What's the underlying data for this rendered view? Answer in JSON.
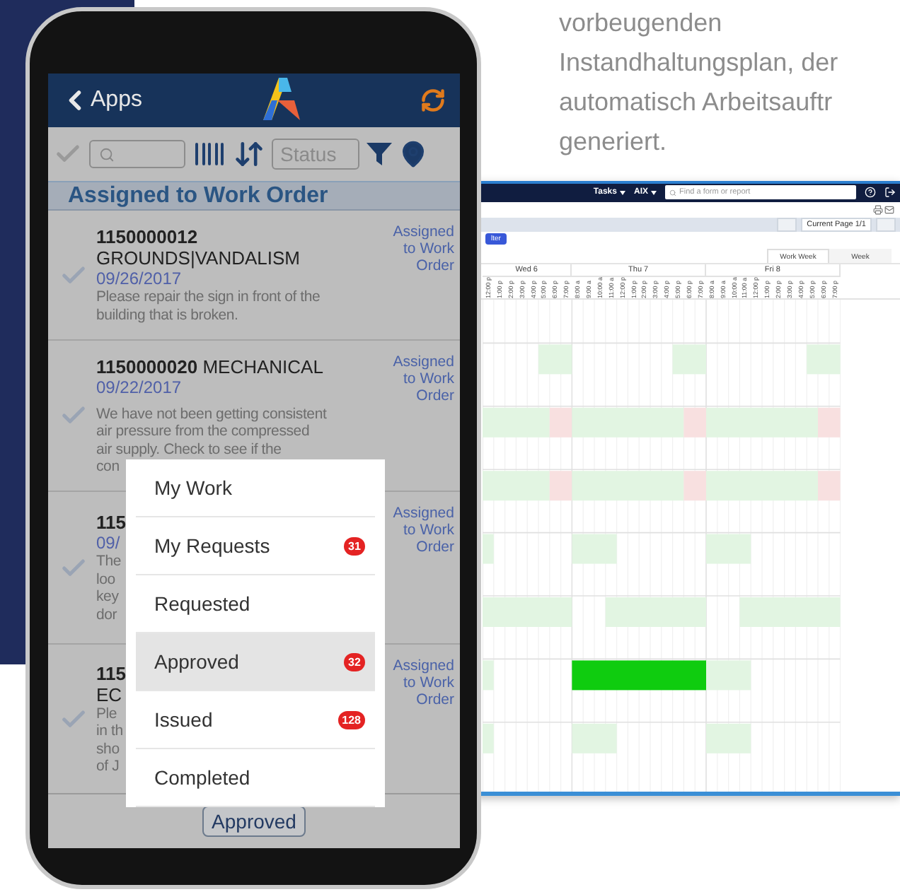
{
  "intro_text": [
    "vorbeugenden",
    "Instandhaltungsplan, der",
    "automatisch Arbeitsauftr",
    "generiert."
  ],
  "phone": {
    "header": {
      "back_label": "Apps"
    },
    "toolbar": {
      "status_placeholder": "Status"
    },
    "section_title": "Assigned to Work Order",
    "work_orders": [
      {
        "title_lines": [
          "**1150000012**",
          "GROUNDS|VANDALISM"
        ],
        "date": "09/26/2017",
        "description": [
          "Please repair the sign in front of the",
          "building that is broken."
        ],
        "status": "Assigned to Work Order"
      },
      {
        "title_lines": [
          "**1150000020** MECHANICAL"
        ],
        "date": "09/22/2017",
        "description": [
          "We have not been getting consistent",
          "air pressure from the compressed",
          "air supply. Check to see if the",
          "con"
        ],
        "status": "Assigned to Work Order"
      },
      {
        "title_lines": [
          "**115**"
        ],
        "date": "09/",
        "description": [
          "The",
          "loo",
          "key",
          "dor"
        ],
        "status": "Assigned to Work Order"
      },
      {
        "title_lines": [
          "**115**",
          "EC"
        ],
        "description": [
          "Ple",
          "in th",
          "sho",
          "of J"
        ],
        "status": "Assigned to Work Order"
      }
    ],
    "status_menu": [
      {
        "label": "My Work",
        "selected": false
      },
      {
        "label": "My Requests",
        "badge": "31",
        "selected": false
      },
      {
        "label": "Requested",
        "selected": false
      },
      {
        "label": "Approved",
        "badge": "32",
        "selected": true
      },
      {
        "label": "Issued",
        "badge": "128",
        "selected": false
      },
      {
        "label": "Completed",
        "selected": false
      }
    ],
    "status_button": "Approved"
  },
  "desktop": {
    "nav": {
      "menus": [
        "Tasks",
        "AIX"
      ],
      "search_placeholder": "Find a form or report"
    },
    "pager": "Current Page 1/1",
    "filter_button": "lter",
    "view_tabs": [
      {
        "label": "Work Week",
        "selected": true
      },
      {
        "label": "Week",
        "selected": false
      }
    ],
    "days": [
      {
        "label": "Wed 6",
        "hours": [
          "12:00 p",
          "1:00 p",
          "2:00 p",
          "3:00 p",
          "4:00 p",
          "5:00 p",
          "6:00 p",
          "7:00 p"
        ]
      },
      {
        "label": "Thu 7",
        "hours": [
          "8:00 a",
          "9:00 a",
          "10:00 a",
          "11:00 a",
          "12:00 p",
          "1:00 p",
          "2:00 p",
          "3:00 p",
          "4:00 p",
          "5:00 p",
          "6:00 p",
          "7:00 p"
        ]
      },
      {
        "label": "Fri 8",
        "hours": [
          "8:00 a",
          "9:00 a",
          "10:00 a",
          "11:00 a",
          "12:00 p",
          "1:00 p",
          "2:00 p",
          "3:00 p",
          "4:00 p",
          "5:00 p",
          "6:00 p",
          "7:00 p"
        ]
      }
    ]
  }
}
